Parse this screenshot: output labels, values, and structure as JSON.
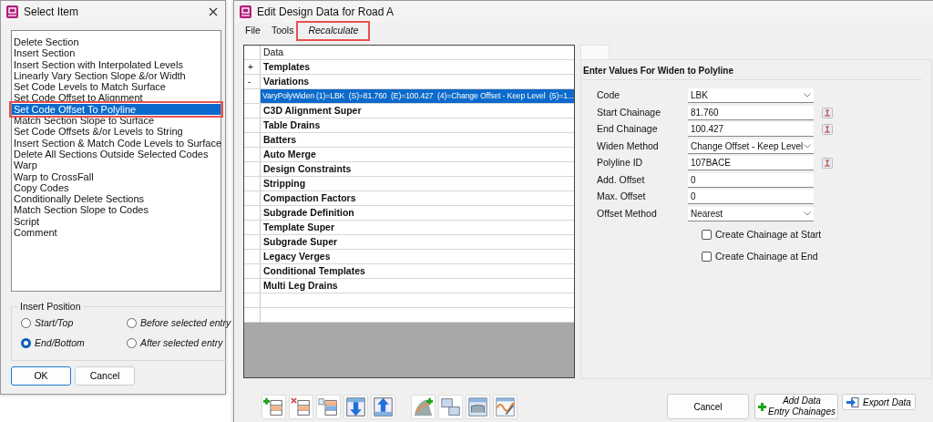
{
  "select_dialog": {
    "title": "Select Item",
    "items": [
      {
        "label": "Delete Section",
        "selected": false,
        "highlighted": false
      },
      {
        "label": "Insert Section",
        "selected": false,
        "highlighted": false
      },
      {
        "label": "Insert Section with Interpolated Levels",
        "selected": false,
        "highlighted": false
      },
      {
        "label": "Linearly Vary Section Slope &/or Width",
        "selected": false,
        "highlighted": false
      },
      {
        "label": "Set Code Levels to Match Surface",
        "selected": false,
        "highlighted": false
      },
      {
        "label": "Set Code Offset to Alignment",
        "selected": false,
        "highlighted": false
      },
      {
        "label": "Set Code Offset To Polyline",
        "selected": true,
        "highlighted": true
      },
      {
        "label": "Match Section Slope to Surface",
        "selected": false,
        "highlighted": false
      },
      {
        "label": "Set Code Offsets &/or Levels to String",
        "selected": false,
        "highlighted": false
      },
      {
        "label": "Insert Section & Match Code Levels to Surface",
        "selected": false,
        "highlighted": false
      },
      {
        "label": "Delete All Sections Outside Selected Codes",
        "selected": false,
        "highlighted": false
      },
      {
        "label": "Warp",
        "selected": false,
        "highlighted": false
      },
      {
        "label": "Warp to CrossFall",
        "selected": false,
        "highlighted": false
      },
      {
        "label": "Copy Codes",
        "selected": false,
        "highlighted": false
      },
      {
        "label": "Conditionally Delete Sections",
        "selected": false,
        "highlighted": false
      },
      {
        "label": "Match Section Slope to Codes",
        "selected": false,
        "highlighted": false
      },
      {
        "label": "Script",
        "selected": false,
        "highlighted": false
      },
      {
        "label": "Comment",
        "selected": false,
        "highlighted": false
      }
    ],
    "insert_position": {
      "label": "Insert Position",
      "options": [
        {
          "label": "Start/Top",
          "selected": false
        },
        {
          "label": "Before selected entry",
          "selected": false
        },
        {
          "label": "End/Bottom",
          "selected": true
        },
        {
          "label": "After selected entry",
          "selected": false
        }
      ]
    },
    "buttons": [
      {
        "label": "OK",
        "default": true
      },
      {
        "label": "Cancel",
        "default": false
      }
    ]
  },
  "edit_dialog": {
    "title": "Edit Design Data for Road A",
    "menu": [
      {
        "label": "File",
        "kind": "menu",
        "highlighted": false
      },
      {
        "label": "Tools",
        "kind": "menu",
        "highlighted": false
      },
      {
        "label": "Recalculate",
        "kind": "command",
        "highlighted": true
      }
    ],
    "table": {
      "header": "Data",
      "rows": [
        {
          "expander": "+",
          "label": "Templates",
          "selected": false
        },
        {
          "expander": "-",
          "label": "Variations",
          "selected": false,
          "children": [
            {
              "label": "VaryPolyWiden (1)=LBK  (S)=81.760  (E)=100.427  (4)=Change Offset - Keep Level  (5)=1...",
              "selected": true
            }
          ]
        },
        {
          "label": "C3D Alignment Super",
          "selected": false
        },
        {
          "label": "Table Drains",
          "selected": false
        },
        {
          "label": "Batters",
          "selected": false
        },
        {
          "label": "Auto Merge",
          "selected": false
        },
        {
          "label": "Design Constraints",
          "selected": false
        },
        {
          "label": "Stripping",
          "selected": false
        },
        {
          "label": "Compaction Factors",
          "selected": false
        },
        {
          "label": "Subgrade Definition",
          "selected": false
        },
        {
          "label": "Template Super",
          "selected": false
        },
        {
          "label": "Subgrade Super",
          "selected": false
        },
        {
          "label": "Legacy Verges",
          "selected": false
        },
        {
          "label": "Conditional Templates",
          "selected": false
        },
        {
          "label": "Multi Leg Drains",
          "selected": false
        }
      ]
    },
    "panel": {
      "title": "Enter Values For Widen to Polyline",
      "fields": [
        {
          "label": "Code",
          "kind": "select",
          "value": "LBK",
          "picker": false
        },
        {
          "label": "Start Chainage",
          "kind": "text",
          "value": "81.760",
          "picker": true
        },
        {
          "label": "End Chainage",
          "kind": "text",
          "value": "100.427",
          "picker": true
        },
        {
          "label": "Widen Method",
          "kind": "select",
          "value": "Change Offset - Keep Level",
          "picker": false
        },
        {
          "label": "Polyline ID",
          "kind": "text",
          "value": "107BACE",
          "picker": true
        },
        {
          "label": "Add. Offset",
          "kind": "text",
          "value": "0",
          "picker": false
        },
        {
          "label": "Max. Offset",
          "kind": "text",
          "value": "0",
          "picker": false
        },
        {
          "label": "Offset Method",
          "kind": "select",
          "value": "Nearest",
          "picker": false
        }
      ],
      "checkboxes": [
        {
          "label": "Create Chainage at Start",
          "checked": false
        },
        {
          "label": "Create Chainage at End",
          "checked": false
        }
      ]
    },
    "buttons": [
      {
        "kind": "cancel",
        "lines": [
          "Cancel"
        ]
      },
      {
        "kind": "add",
        "lines": [
          "Add Data",
          "Entry Chainages"
        ]
      },
      {
        "kind": "export",
        "lines": [
          "Export Data"
        ]
      }
    ]
  }
}
